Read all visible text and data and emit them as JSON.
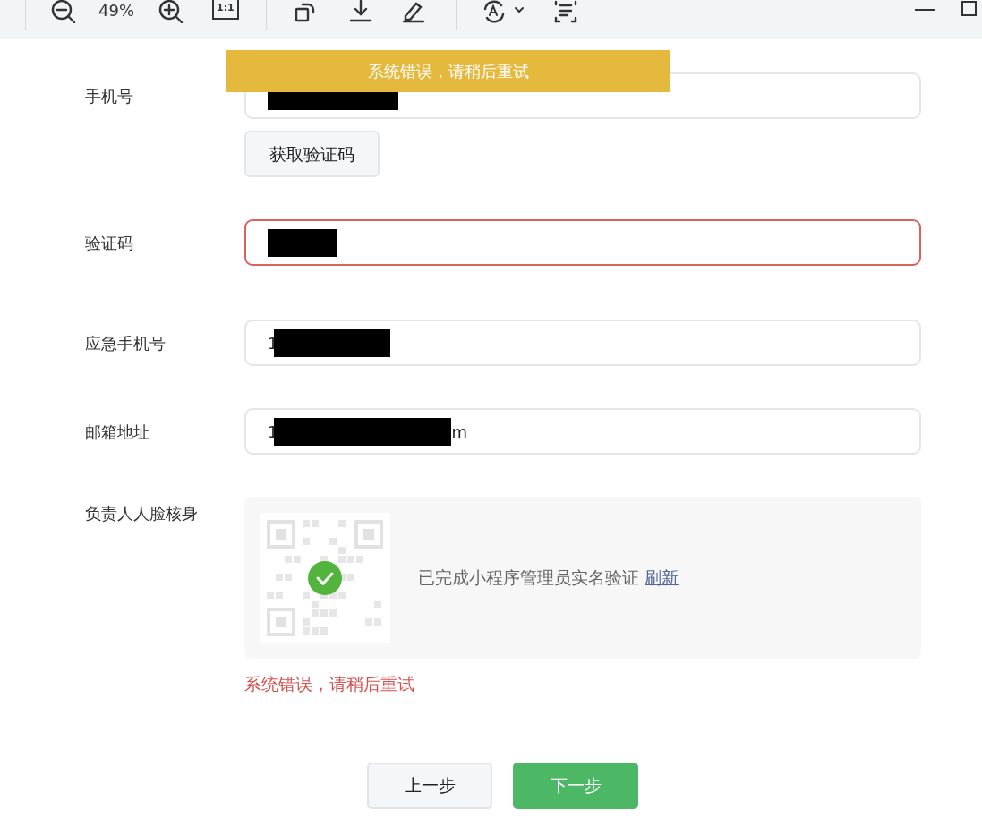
{
  "toolbar": {
    "zoom": "49%",
    "actual_size": "1:1"
  },
  "toast": {
    "text": "系统错误，请稍后重试"
  },
  "rows": [
    {
      "kind": "input",
      "label": "手机号",
      "error": false,
      "segments": [
        {
          "kind": "redaction"
        }
      ]
    },
    {
      "kind": "button",
      "text": "获取验证码"
    },
    {
      "kind": "input",
      "label": "验证码",
      "error": true,
      "segments": [
        {
          "kind": "redaction"
        }
      ]
    },
    {
      "kind": "input",
      "label": "应急手机号",
      "error": false,
      "segments": [
        {
          "kind": "text",
          "text": "1"
        },
        {
          "kind": "redaction"
        }
      ]
    },
    {
      "kind": "input",
      "label": "邮箱地址",
      "error": false,
      "segments": [
        {
          "kind": "text",
          "text": "1"
        },
        {
          "kind": "redaction"
        },
        {
          "kind": "text",
          "text": "m"
        }
      ]
    },
    {
      "kind": "face",
      "label": "负责人人脸核身",
      "verified": true,
      "status": "已完成小程序管理员实名验证",
      "link": "刷新",
      "error": "系统错误，请稍后重试"
    }
  ],
  "buttons": [
    {
      "kind": "secondary",
      "text": "上一步"
    },
    {
      "kind": "primary",
      "text": "下一步"
    }
  ]
}
